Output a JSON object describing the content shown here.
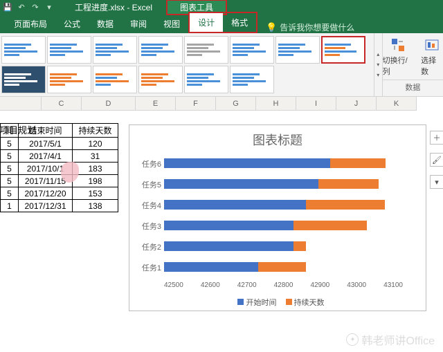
{
  "titlebar": {
    "filename": "工程进度.xlsx - Excel",
    "chart_tools": "图表工具"
  },
  "tabs": {
    "layout": "页面布局",
    "formula": "公式",
    "data": "数据",
    "review": "审阅",
    "view": "视图",
    "design": "设计",
    "format": "格式",
    "tellme": "告诉我你想要做什么"
  },
  "ribbon_right": {
    "switch": "切换行/列",
    "select": "选择数",
    "group": "数据"
  },
  "columns": {
    "C": "C",
    "D": "D",
    "E": "E",
    "F": "F",
    "G": "G",
    "H": "H",
    "I": "I",
    "J": "J",
    "K": "K"
  },
  "table": {
    "plan_title": "项目规划",
    "h_time": "间",
    "h_end": "结束时间",
    "h_days": "持续天数",
    "rows": [
      {
        "t": "5",
        "end": "2017/5/1",
        "days": "120"
      },
      {
        "t": "5",
        "end": "2017/4/1",
        "days": "31"
      },
      {
        "t": "5",
        "end": "2017/10/1",
        "days": "183"
      },
      {
        "t": "5",
        "end": "2017/11/15",
        "days": "198"
      },
      {
        "t": "5",
        "end": "2017/12/20",
        "days": "153"
      },
      {
        "t": "1",
        "end": "2017/12/31",
        "days": "138"
      }
    ]
  },
  "chart": {
    "title": "图表标题",
    "legend": {
      "s1": "开始时间",
      "s2": "持续天数"
    },
    "xticks": [
      "42500",
      "42600",
      "42700",
      "42800",
      "42900",
      "43000",
      "43100"
    ]
  },
  "chart_data": {
    "type": "bar",
    "orientation": "horizontal_stacked",
    "categories": [
      "任务1",
      "任务2",
      "任务3",
      "任务4",
      "任务5",
      "任务6"
    ],
    "series": [
      {
        "name": "开始时间",
        "values": [
          42736,
          42826,
          42826,
          42857,
          42887,
          42918
        ]
      },
      {
        "name": "持续天数",
        "values": [
          120,
          31,
          183,
          198,
          153,
          138
        ]
      }
    ],
    "xlabel": "",
    "ylabel": "",
    "xlim": [
      42500,
      43100
    ],
    "title": "图表标题"
  },
  "watermark": "韩老师讲Office"
}
